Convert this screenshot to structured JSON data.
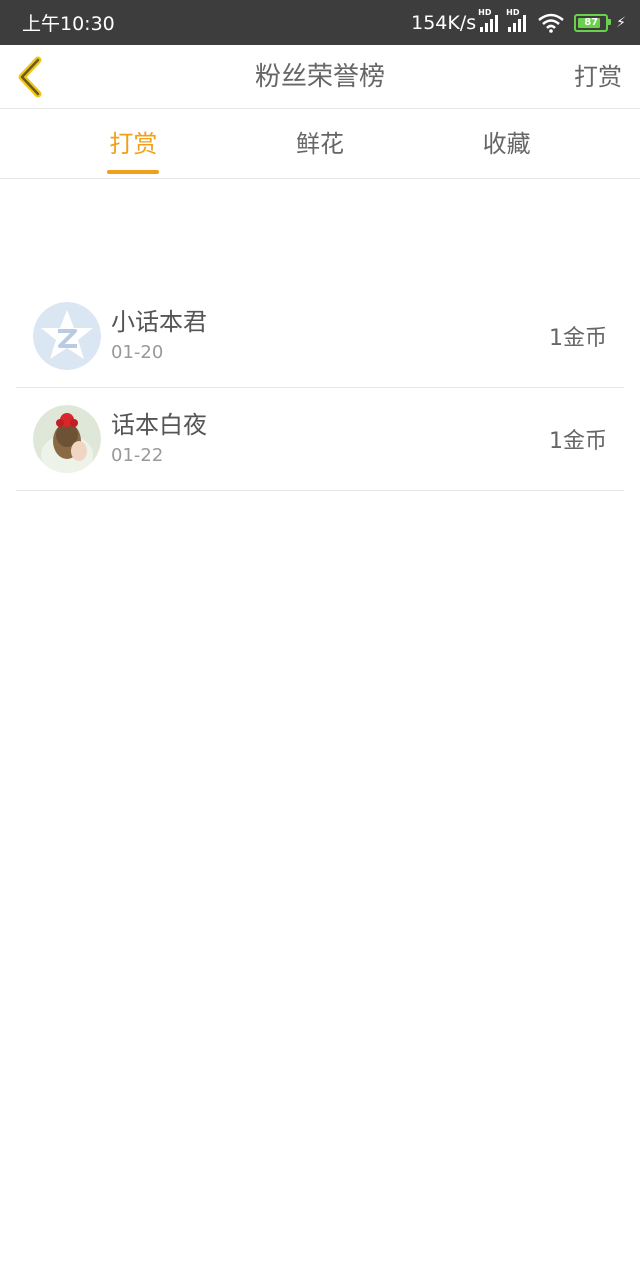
{
  "status_bar": {
    "time": "上午10:30",
    "net_speed": "154K/s",
    "signal_tag": "HD",
    "battery": "87"
  },
  "header": {
    "title": "粉丝荣誉榜",
    "action": "打赏"
  },
  "tabs": [
    {
      "label": "打赏",
      "active": true
    },
    {
      "label": "鲜花",
      "active": false
    },
    {
      "label": "收藏",
      "active": false
    }
  ],
  "records": [
    {
      "name": "小话本君",
      "date": "01-20",
      "amount": "1金币",
      "avatar": "default-star-avatar"
    },
    {
      "name": "话本白夜",
      "date": "01-22",
      "amount": "1金币",
      "avatar": "photo-avatar"
    }
  ],
  "colors": {
    "accent": "#f0a01c",
    "status_bar": "#3d3d3d",
    "battery": "#6ad14a"
  }
}
